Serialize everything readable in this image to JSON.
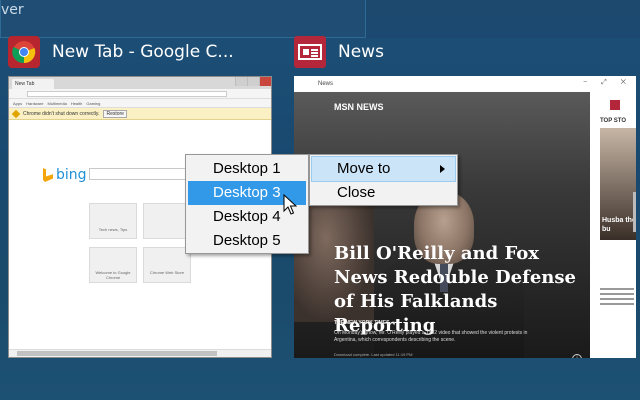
{
  "background": {
    "window_title_fragment": "ver"
  },
  "windows": [
    {
      "icon": "chrome-icon",
      "title": "New Tab - Google C...",
      "thumbnail": {
        "tab_label": "New Tab",
        "bookmarks": [
          "Apps",
          "Hardware",
          "Multimedia",
          "Health",
          "Gaming"
        ],
        "infobar_text": "Chrome didn't shut down correctly.",
        "infobar_button": "Restore",
        "search_brand": "bing",
        "tile_labels": [
          "Tech news, Tips",
          "",
          "",
          "",
          "Welcome to Google Chrome",
          "Chrome Web Store"
        ]
      }
    },
    {
      "icon": "news-icon",
      "title": "News",
      "thumbnail": {
        "app_title": "News",
        "section_label": "MSN NEWS",
        "headline": "Bill O'Reilly and Fox News Redouble Defense of His Falklands Reporting",
        "source": "THE NEW YORK TIMES",
        "summary": "On Monday's show, Mr. O'Reilly played a 1982 video that showed the violent protests in Argentina, which correspondents describing the scene.",
        "footnote": "Download complete. Last updated 11:19 PM",
        "side_label": "TOP STO",
        "side_caption": "Husba the bu"
      }
    }
  ],
  "context_menu": {
    "items": [
      {
        "label": "Move to",
        "has_submenu": true
      },
      {
        "label": "Close",
        "has_submenu": false
      }
    ]
  },
  "submenu": {
    "items": [
      {
        "label": "Desktop 1"
      },
      {
        "label": "Desktop 3"
      },
      {
        "label": "Desktop 4"
      },
      {
        "label": "Desktop 5"
      }
    ],
    "highlighted_index": 1
  },
  "colors": {
    "desktop_bg": "#1a4a6c",
    "menu_highlight": "#3299e8",
    "menu_hover": "#cce4f7",
    "news_brand": "#b4273a"
  }
}
